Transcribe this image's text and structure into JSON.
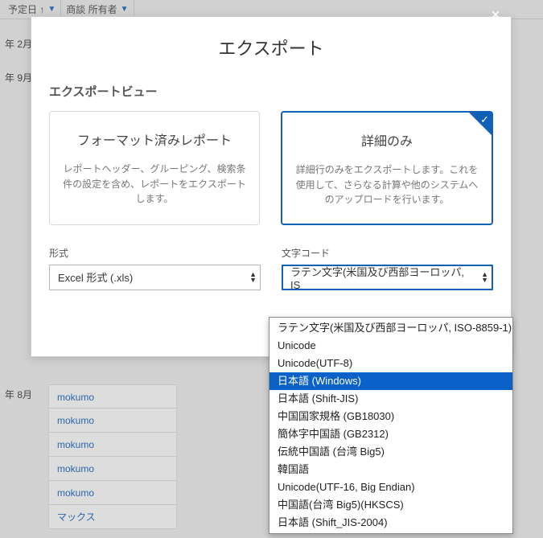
{
  "background": {
    "header_cells": [
      "予定日 ↑",
      "商談 所有者"
    ],
    "left_labels": [
      "年 2月",
      "年 9月",
      "年 8月"
    ],
    "table_values": [
      "mokumo",
      "mokumo",
      "mokumo",
      "mokumo",
      "mokumo",
      "マックス"
    ]
  },
  "dialog": {
    "title": "エクスポート",
    "close_label": "×",
    "section_title": "エクスポートビュー",
    "card_formatted": {
      "title": "フォーマット済みレポート",
      "desc": "レポートヘッダー、グルーピング、検索条件の設定を含め、レポートをエクスポートします。"
    },
    "card_details": {
      "title": "詳細のみ",
      "desc": "詳細行のみをエクスポートします。これを使用して、さらなる計算や他のシステムへのアップロードを行います。"
    },
    "format_label": "形式",
    "format_value": "Excel 形式 (.xls)",
    "encoding_label": "文字コード",
    "encoding_value": "ラテン文字(米国及び西部ヨーロッパ, IS",
    "encoding_options": [
      "ラテン文字(米国及び西部ヨーロッパ, ISO-8859-1)",
      "Unicode",
      "Unicode(UTF-8)",
      "日本語 (Windows)",
      "日本語 (Shift-JIS)",
      "中国国家規格 (GB18030)",
      "簡体字中国語 (GB2312)",
      "伝統中国語 (台湾 Big5)",
      "韓国語",
      "Unicode(UTF-16, Big Endian)",
      "中国語(台湾 Big5)(HKSCS)",
      "日本語 (Shift_JIS-2004)"
    ],
    "encoding_selected_index": 3
  }
}
